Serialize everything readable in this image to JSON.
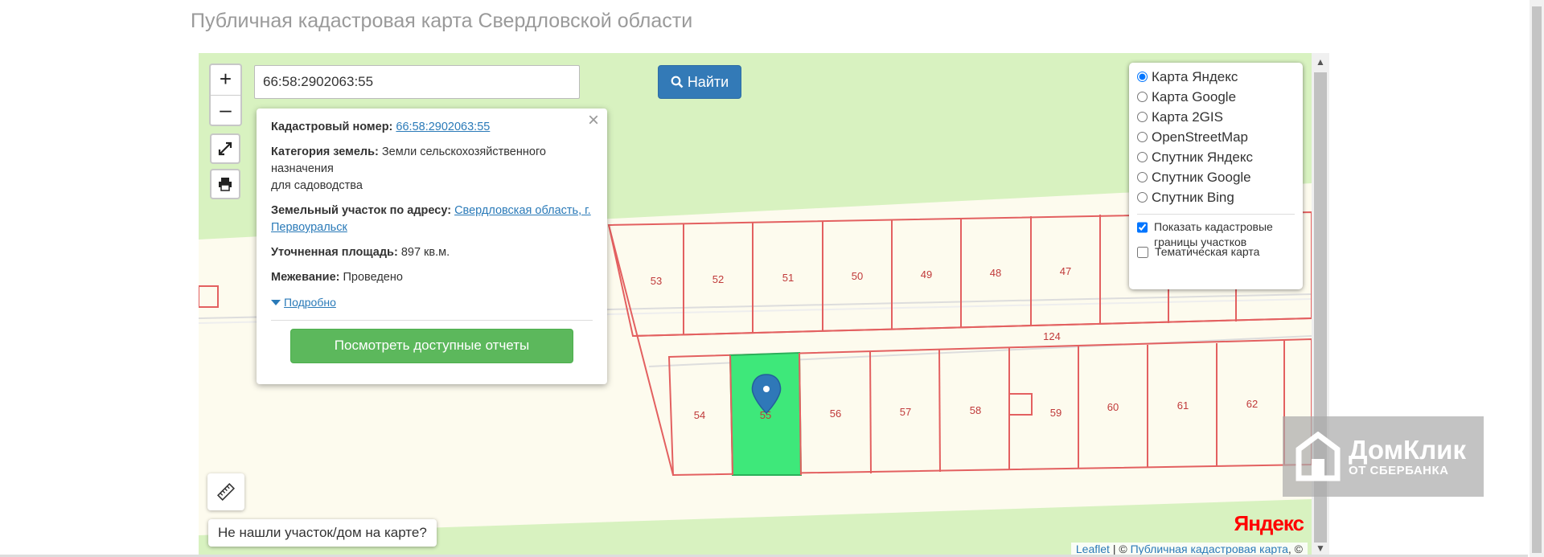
{
  "page": {
    "title": "Публичная кадастровая карта Свердловской области"
  },
  "search": {
    "value": "66:58:2902063:55",
    "button_label": "Найти"
  },
  "zoom": {
    "in": "+",
    "out": "–"
  },
  "popup": {
    "cadastral_label": "Кадастровый номер:",
    "cadastral_value": "66:58:2902063:55",
    "category_label": "Категория земель:",
    "category_value": "Земли сельскохозяйственного назначения",
    "category_use": "для садоводства",
    "address_label": "Земельный участок по адресу:",
    "address_value": "Свердловская область, г. Первоуральск",
    "area_label": "Уточненная площадь:",
    "area_value": "897 кв.м.",
    "survey_label": "Межевание:",
    "survey_value": "Проведено",
    "more_label": "Подробно",
    "report_button": "Посмотреть доступные отчеты",
    "close": "×"
  },
  "layers": {
    "options": [
      {
        "label": "Карта Яндекс",
        "checked": true
      },
      {
        "label": "Карта Google",
        "checked": false
      },
      {
        "label": "Карта 2GIS",
        "checked": false
      },
      {
        "label": "OpenStreetMap",
        "checked": false
      },
      {
        "label": "Спутник Яндекс",
        "checked": false
      },
      {
        "label": "Спутник Google",
        "checked": false
      },
      {
        "label": "Спутник Bing",
        "checked": false
      }
    ],
    "show_borders": "Показать кадастровые границы участков",
    "thematic": "Тематическая карта"
  },
  "parcels": {
    "top_row": [
      "53",
      "52",
      "51",
      "50",
      "49",
      "48",
      "47"
    ],
    "bottom_row": [
      "54",
      "55",
      "56",
      "57",
      "58",
      "59",
      "60",
      "61",
      "62"
    ],
    "road": "124"
  },
  "notfound": "Не нашли участок/дом на карте?",
  "attribution": {
    "leaflet": "Leaflet",
    "sep": " | © ",
    "pkk": "Публичная кадастровая карта",
    "tail": ", ©"
  },
  "yandex_logo": "Яндекс",
  "watermark": {
    "line1": "ДомКлик",
    "line2": "ОТ СБЕРБАНКА"
  },
  "colors": {
    "search_button": "#337ab7",
    "report_button": "#5cb85c",
    "parcel_border": "#e36060",
    "selected_parcel": "#3ee87a",
    "grass": "#d8f2c0"
  }
}
